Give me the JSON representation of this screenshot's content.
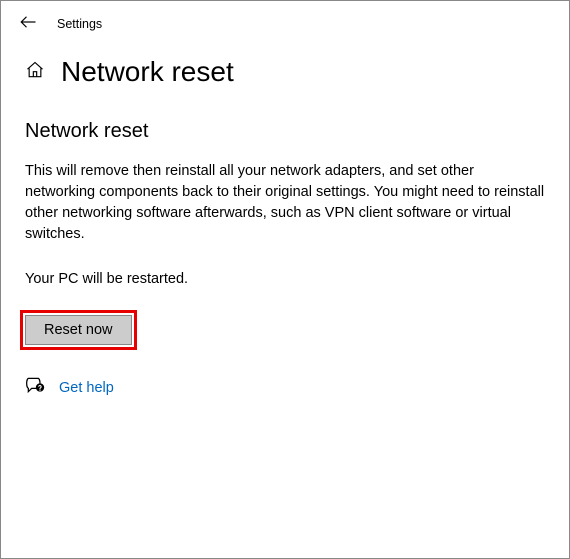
{
  "topbar": {
    "app_title": "Settings"
  },
  "header": {
    "page_title": "Network reset"
  },
  "main": {
    "section_heading": "Network reset",
    "description": "This will remove then reinstall all your network adapters, and set other networking components back to their original settings. You might need to reinstall other networking software afterwards, such as VPN client software or virtual switches.",
    "restart_warning": "Your PC will be restarted.",
    "reset_button_label": "Reset now"
  },
  "footer": {
    "help_link_label": "Get help"
  }
}
